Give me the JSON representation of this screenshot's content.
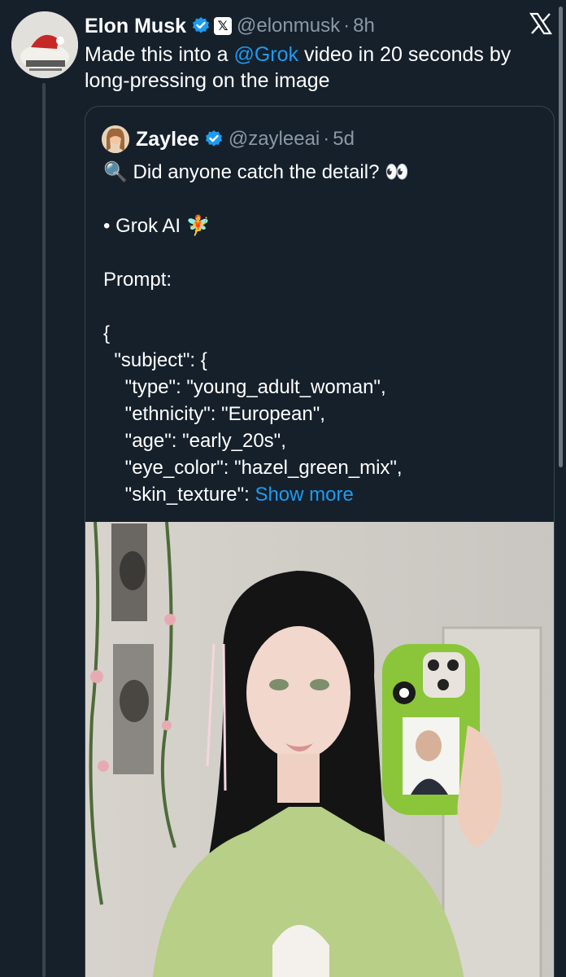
{
  "tweet": {
    "author_name": "Elon Musk",
    "author_handle": "@elonmusk",
    "x_badge": "𝕏",
    "separator": "·",
    "time": "8h",
    "text_before_mention": "Made this into a ",
    "mention": "@Grok",
    "text_after_mention": " video in 20 seconds by long-pressing on the image"
  },
  "quote": {
    "author_name": "Zaylee",
    "author_handle": "@zayleeai",
    "separator": "·",
    "time": "5d",
    "lines": [
      "🔍 Did anyone catch the detail? 👀",
      "",
      "• Grok AI 🧚",
      "",
      "Prompt:",
      "",
      "{",
      "  \"subject\": {",
      "    \"type\": \"young_adult_woman\",",
      "    \"ethnicity\": \"European\",",
      "    \"age\": \"early_20s\",",
      "    \"eye_color\": \"hazel_green_mix\","
    ],
    "last_line_prefix": "    \"skin_texture\": ",
    "show_more": "Show more"
  },
  "icons": {
    "verified": "verified-badge-icon",
    "close": "x-logo-icon"
  },
  "colors": {
    "background": "#15202b",
    "link": "#1d9bf0",
    "muted": "#8b98a5",
    "border": "#38444d",
    "phone_case": "#8bc53a"
  }
}
